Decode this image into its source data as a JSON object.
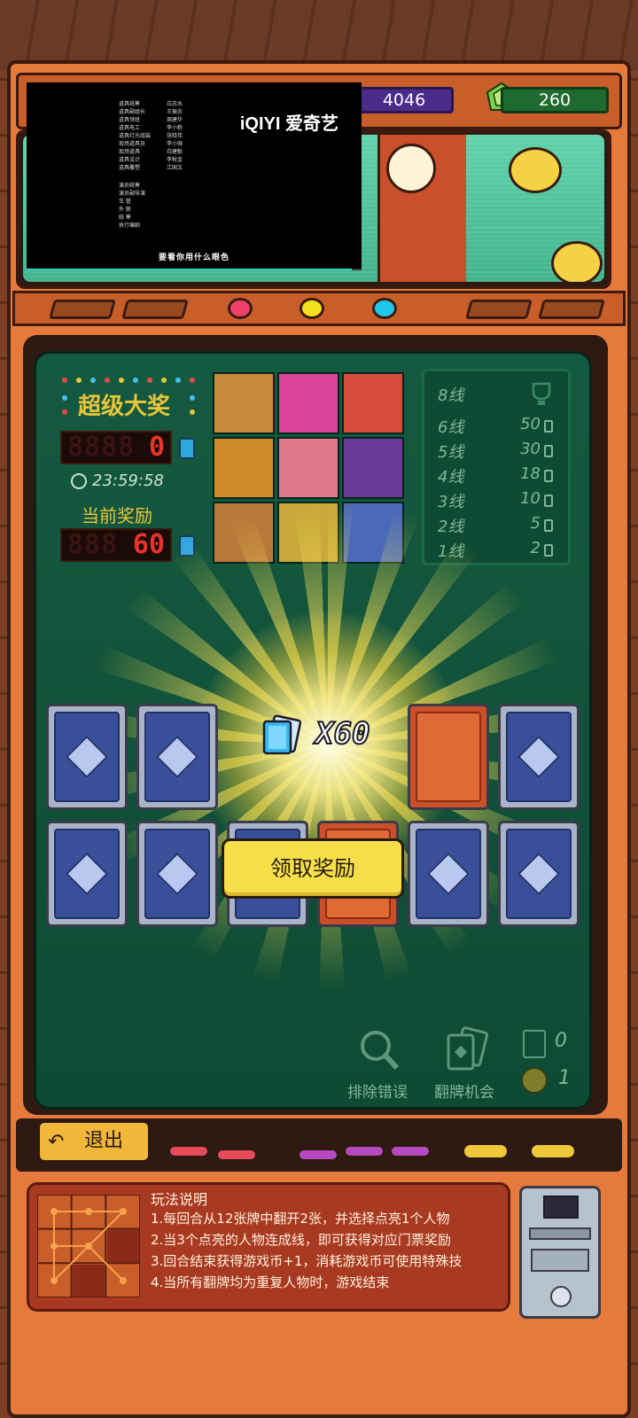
{
  "header": {
    "coins": "4046",
    "gems": "260"
  },
  "video_overlay": {
    "logo": "iQIYI 爱奇艺",
    "caption": "要看你用什么眼色",
    "progress": 0.97,
    "credits_left": [
      "道具统筹",
      "道具副组长",
      "道具领班",
      "道具电工",
      "道具灯光组装",
      "现场道具员",
      "现场道具",
      "道具设计",
      "道具雕塑"
    ],
    "credits_mid": [
      "白志水",
      "王振忠",
      "周建华",
      "李小粉",
      "张晓伟",
      "李小强",
      "白建魁",
      "李秋金",
      "江国文"
    ],
    "credits_lower": [
      "演员统筹",
      "演员副导演",
      "车 管",
      "外 联",
      "统 筹",
      "执行编剧"
    ]
  },
  "jackpot": {
    "title": "超级大奖",
    "value": "0",
    "timer": "23:59:58",
    "current_title": "当前奖励",
    "current_value": "60"
  },
  "paytable": [
    {
      "label": "8线",
      "value": ""
    },
    {
      "label": "6线",
      "value": "50"
    },
    {
      "label": "5线",
      "value": "30"
    },
    {
      "label": "4线",
      "value": "18"
    },
    {
      "label": "3线",
      "value": "10"
    },
    {
      "label": "2线",
      "value": "5"
    },
    {
      "label": "1线",
      "value": "2"
    }
  ],
  "reward": {
    "amount": "X60",
    "claim_label": "领取奖励"
  },
  "tools": {
    "remove_error_label": "排除错误",
    "flip_chance_label": "翻牌机会",
    "ticket_count": "0",
    "coin_count": "1"
  },
  "controls": {
    "exit_label": "退出"
  },
  "rules": {
    "title": "玩法说明",
    "lines": [
      "1.每回合从12张牌中翻开2张，并选择点亮1个人物",
      "2.当3个点亮的人物连成线，即可获得对应门票奖励",
      "3.回合结束获得游戏币+1，消耗游戏币可使用特殊技",
      "4.当所有翻牌均为重复人物时，游戏结束"
    ]
  },
  "colors": {
    "cabinet": "#e67a3c",
    "panel": "#145a40",
    "gold": "#e9c53a",
    "led_red": "#e8332a",
    "claim_yellow": "#f6e04a"
  }
}
